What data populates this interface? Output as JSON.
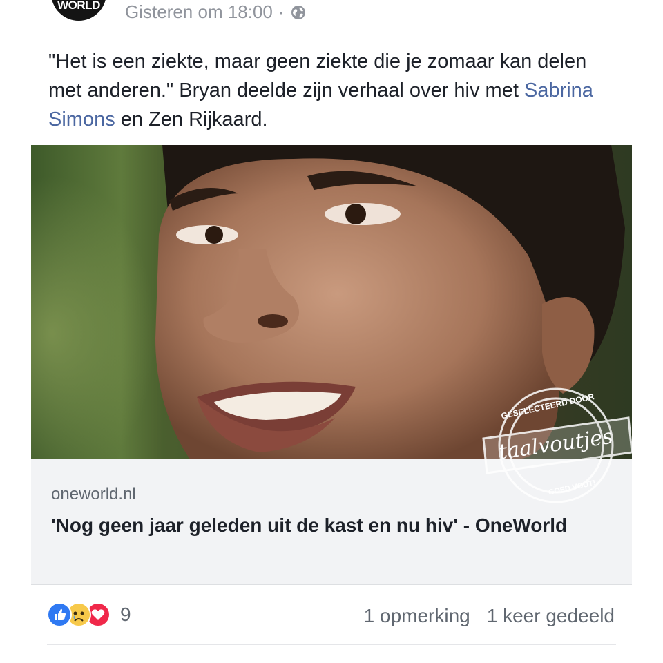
{
  "post": {
    "avatar_text": "WORLD",
    "timestamp": "Gisteren om 18:00",
    "separator": "·",
    "privacy_icon": "globe-icon",
    "text_part1": "\"Het is een ziekte, maar geen ziekte die je zomaar kan delen met anderen.\" Bryan deelde zijn verhaal over hiv met ",
    "tagged_person": "Sabrina Simons",
    "text_part2": " en Zen Rijkaard."
  },
  "link": {
    "source": "oneworld.nl",
    "title": "'Nog geen jaar geleden uit de kast en nu hiv' - OneWorld"
  },
  "watermark": {
    "top_text": "GESELECTEERD DOOR",
    "brand": "taalvoutjes",
    "bottom_text": "GOED VOUT!"
  },
  "footer": {
    "reactions": [
      "like-icon",
      "sad-icon",
      "love-icon"
    ],
    "reaction_count": "9",
    "comments": "1 opmerking",
    "shares": "1 keer gedeeld"
  },
  "colors": {
    "link_blue": "#4b67a1",
    "meta_gray": "#90949c",
    "like_blue": "#2f79f2",
    "love_red": "#f0284a",
    "sad_yellow": "#f7c94a"
  }
}
